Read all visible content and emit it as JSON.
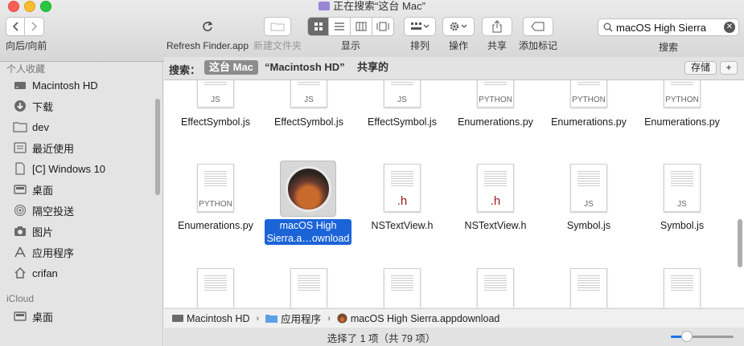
{
  "window": {
    "title": "正在搜索“这台 Mac”"
  },
  "toolbar": {
    "nav_label": "向后/向前",
    "refresh_label": "Refresh Finder.app",
    "new_folder_label": "新建文件夹",
    "view_label": "显示",
    "arrange_label": "排列",
    "action_label": "操作",
    "share_label": "共享",
    "tag_label": "添加标记",
    "search_label": "搜索"
  },
  "search": {
    "value": "macOS High Sierra"
  },
  "scope": {
    "label": "搜索：",
    "options": [
      "这台 Mac",
      "“Macintosh HD”",
      "共享的"
    ],
    "selected": "这台 Mac",
    "save_label": "存储",
    "add_label": "+"
  },
  "sidebar": {
    "favorites_title": "个人收藏",
    "items": [
      {
        "label": "Macintosh HD",
        "icon": "hard-drive-icon"
      },
      {
        "label": "下载",
        "icon": "download-icon"
      },
      {
        "label": "dev",
        "icon": "folder-icon"
      },
      {
        "label": "最近使用",
        "icon": "recents-icon"
      },
      {
        "label": "[C] Windows 10",
        "icon": "document-icon"
      },
      {
        "label": "桌面",
        "icon": "desktop-icon"
      },
      {
        "label": "隔空投送",
        "icon": "airdrop-icon"
      },
      {
        "label": "图片",
        "icon": "camera-icon"
      },
      {
        "label": "应用程序",
        "icon": "applications-icon"
      },
      {
        "label": "crifan",
        "icon": "home-icon"
      }
    ],
    "icloud_title": "iCloud",
    "icloud_items": [
      {
        "label": "桌面",
        "icon": "desktop-icon"
      }
    ]
  },
  "files": {
    "row1": [
      {
        "name": "EffectSymbol.js",
        "ext": "JS"
      },
      {
        "name": "EffectSymbol.js",
        "ext": "JS"
      },
      {
        "name": "EffectSymbol.js",
        "ext": "JS"
      },
      {
        "name": "Enumerations.py",
        "ext": "PYTHON"
      },
      {
        "name": "Enumerations.py",
        "ext": "PYTHON"
      },
      {
        "name": "Enumerations.py",
        "ext": "PYTHON"
      }
    ],
    "row2": [
      {
        "name": "Enumerations.py",
        "ext": "PYTHON"
      },
      {
        "name_line1": "macOS High",
        "name_line2": "Sierra.a…ownload",
        "selected": true
      },
      {
        "name": "NSTextView.h",
        "ext": ".h"
      },
      {
        "name": "NSTextView.h",
        "ext": ".h"
      },
      {
        "name": "Symbol.js",
        "ext": "JS"
      },
      {
        "name": "Symbol.js",
        "ext": "JS"
      }
    ]
  },
  "pathbar": {
    "segments": [
      "Macintosh HD",
      "应用程序",
      "macOS High Sierra.appdownload"
    ]
  },
  "status": {
    "text": "选择了 1 项（共 79 项）",
    "zoom_fraction": 0.25
  },
  "colors": {
    "selection": "#1b64d8",
    "header_ext": "#a3181b"
  }
}
